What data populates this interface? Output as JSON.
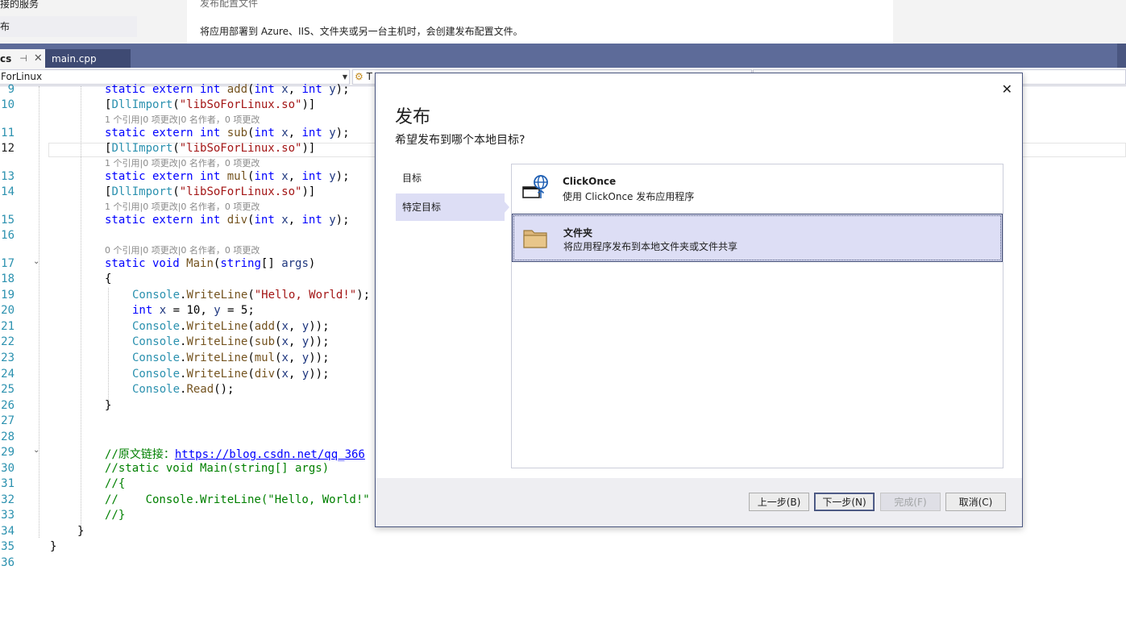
{
  "solution_explorer": {
    "items": [
      "接的服务",
      "布"
    ]
  },
  "description": {
    "title": "发布配置文件",
    "text": "将应用部署到 Azure、IIS、文件夹或另一台主机时，会创建发布配置文件。"
  },
  "tabs": [
    {
      "label": "cs",
      "pin": "⊣",
      "close": "✕",
      "active": true
    },
    {
      "label": "main.cpp",
      "active": false
    }
  ],
  "navbar": {
    "project": "ForLinux",
    "type_box": "T",
    "member_box": ""
  },
  "editor": {
    "line_numbers": [
      "9",
      "10",
      "11",
      "12",
      "13",
      "14",
      "15",
      "16",
      "17",
      "18",
      "19",
      "20",
      "21",
      "22",
      "23",
      "24",
      "25",
      "26",
      "27",
      "28",
      "29",
      "30",
      "31",
      "32",
      "33",
      "34",
      "35",
      "36"
    ],
    "current_line": "12",
    "code_lens": "1 个引用|0 项更改|0 名作者，0 项更改",
    "code_lens_zero": "0 个引用|0 项更改|0 名作者，0 项更改",
    "link": "https://blog.csdn.net/qq_366"
  },
  "dialog": {
    "title": "发布",
    "subtitle": "希望发布到哪个本地目标?",
    "close_label": "✕",
    "steps": [
      {
        "label": "目标",
        "selected": false
      },
      {
        "label": "特定目标",
        "selected": true
      }
    ],
    "targets": [
      {
        "name": "ClickOnce",
        "description": "使用 ClickOnce 发布应用程序",
        "icon": "globe-window-icon",
        "selected": false
      },
      {
        "name": "文件夹",
        "description": "将应用程序发布到本地文件夹或文件共享",
        "icon": "folder-icon",
        "selected": true
      }
    ],
    "buttons": {
      "back": "上一步(B)",
      "next": "下一步(N)",
      "finish": "完成(F)",
      "cancel": "取消(C)"
    }
  },
  "colors": {
    "accent": "#5d6b99",
    "selection": "#dddef5",
    "keyword": "#0000ff",
    "type": "#2b91af",
    "string": "#a31515",
    "comment": "#008000"
  }
}
